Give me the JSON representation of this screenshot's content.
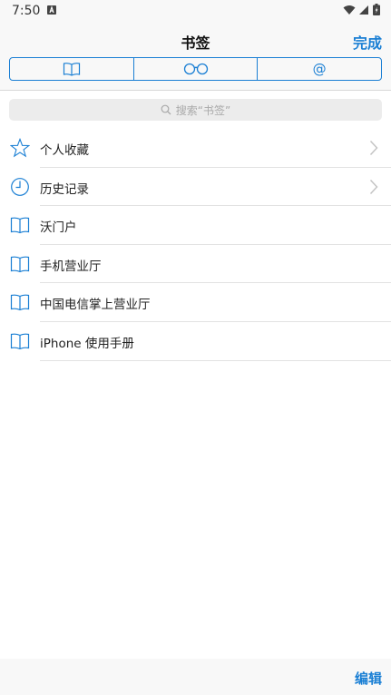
{
  "status_bar": {
    "time": "7:50"
  },
  "nav": {
    "title": "书签",
    "done_label": "完成"
  },
  "segments": [
    {
      "icon": "book-icon"
    },
    {
      "icon": "glasses-icon"
    },
    {
      "icon": "at-icon",
      "label": "@"
    }
  ],
  "search": {
    "placeholder": "搜索“书签”"
  },
  "list": {
    "items": [
      {
        "label": "个人收藏",
        "icon": "star-icon",
        "chevron": true
      },
      {
        "label": "历史记录",
        "icon": "clock-icon",
        "chevron": true
      },
      {
        "label": "沃门户",
        "icon": "book-icon",
        "chevron": false
      },
      {
        "label": "手机营业厅",
        "icon": "book-icon",
        "chevron": false
      },
      {
        "label": "中国电信掌上营业厅",
        "icon": "book-icon",
        "chevron": false
      },
      {
        "label": "iPhone 使用手册",
        "icon": "book-icon",
        "chevron": false
      }
    ]
  },
  "toolbar": {
    "edit_label": "编辑"
  },
  "colors": {
    "accent": "#1a7fd4",
    "bar_background": "#f8f8f8"
  }
}
